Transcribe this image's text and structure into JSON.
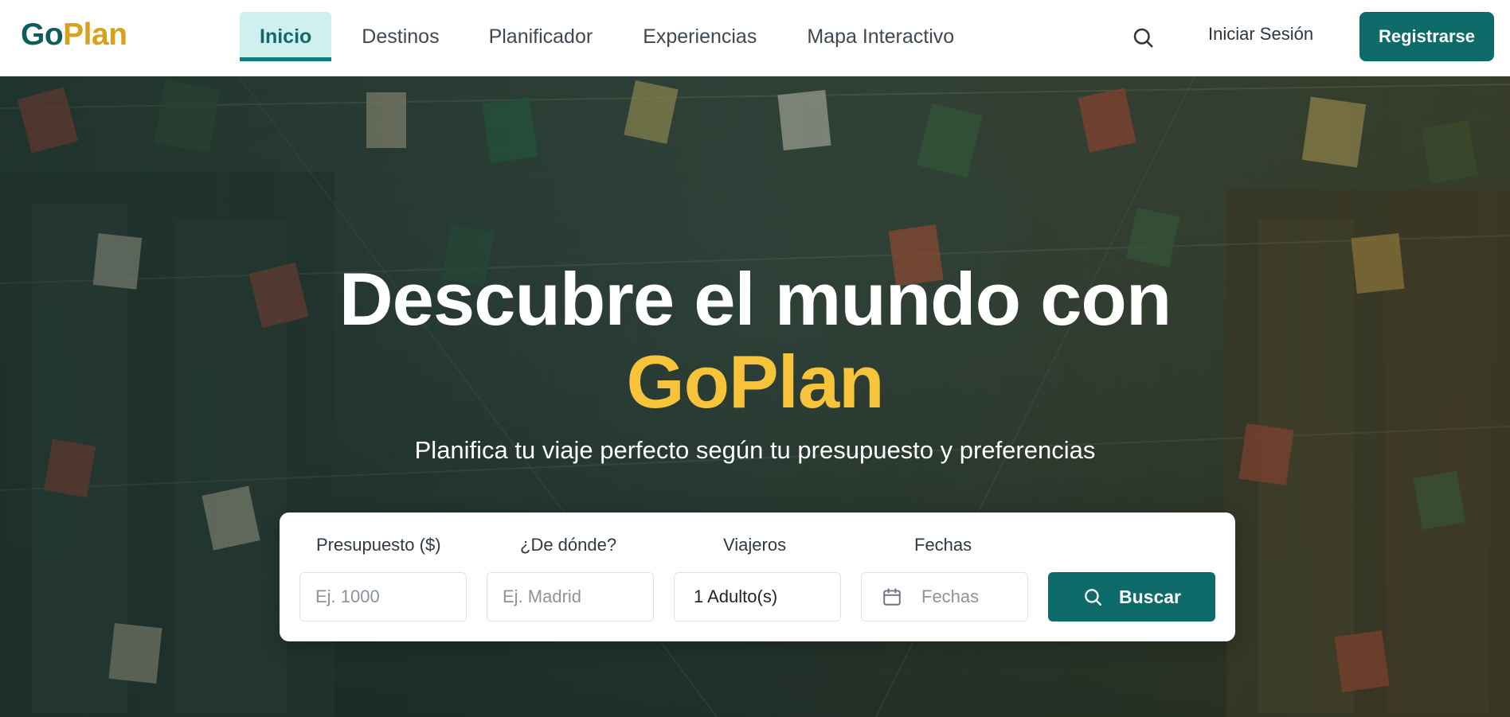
{
  "brand": {
    "go": "Go",
    "plan": "Plan"
  },
  "nav": {
    "items": [
      {
        "label": "Inicio",
        "active": true
      },
      {
        "label": "Destinos"
      },
      {
        "label": "Planificador"
      },
      {
        "label": "Experiencias"
      },
      {
        "label": "Mapa Interactivo"
      }
    ]
  },
  "header": {
    "search_icon": "search-icon",
    "login_label": "Iniciar Sesión",
    "register_label": "Registrarse"
  },
  "hero": {
    "title_line1": "Descubre el mundo con",
    "title_accent": "GoPlan",
    "subtitle": "Planifica tu viaje perfecto según tu presupuesto y preferencias"
  },
  "search_form": {
    "budget": {
      "label": "Presupuesto ($)",
      "placeholder": "Ej. 1000"
    },
    "origin": {
      "label": "¿De dónde?",
      "placeholder": "Ej. Madrid"
    },
    "travelers": {
      "label": "Viajeros",
      "value": "1 Adulto(s)"
    },
    "dates": {
      "label": "Fechas",
      "placeholder": "Fechas",
      "icon": "calendar-icon"
    },
    "submit_label": "Buscar"
  },
  "colors": {
    "primary": "#0f6b69",
    "accent_gold": "#f6c33a",
    "logo_gold": "#d6a21e",
    "nav_active_bg": "#cff0ef"
  }
}
